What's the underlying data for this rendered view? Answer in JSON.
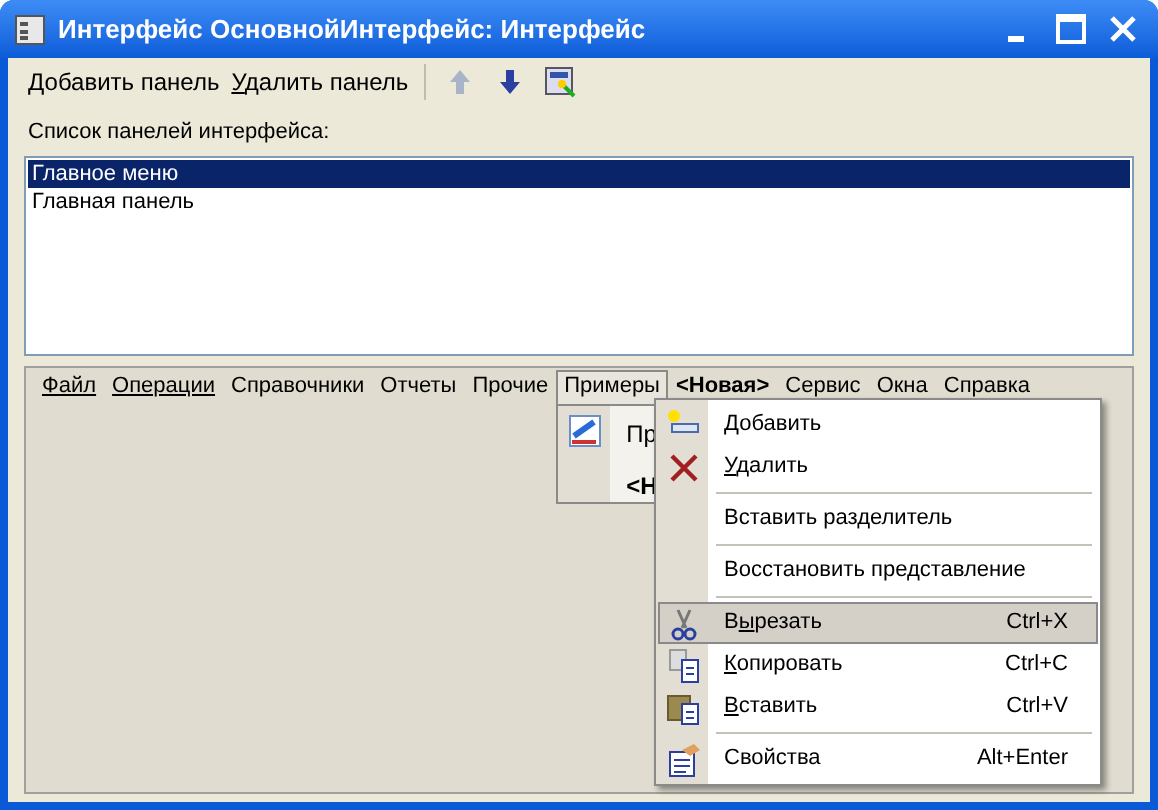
{
  "window": {
    "title": "Интерфейс ОсновнойИнтерфейс: Интерфейс"
  },
  "toolbar": [
    {
      "kind": "text",
      "key": "Д",
      "post": "обавить панель",
      "disabled": false
    },
    {
      "kind": "text",
      "key": "У",
      "post": "далить панель",
      "disabled": false
    },
    {
      "kind": "up",
      "disabled": true
    },
    {
      "kind": "down",
      "disabled": false
    },
    {
      "kind": "wizard"
    }
  ],
  "panels_label": "Список панелей интерфейса:",
  "panels": [
    {
      "label": "Главное меню",
      "selected": true
    },
    {
      "label": "Главная панель",
      "selected": false
    }
  ],
  "menu_bar": [
    {
      "label": "Файл",
      "underlined": true,
      "bold": false,
      "selected": false
    },
    {
      "label": "Операции",
      "underlined": true,
      "bold": false,
      "selected": false
    },
    {
      "label": "Справочники",
      "underlined": false,
      "bold": false,
      "selected": false
    },
    {
      "label": "Отчеты",
      "underlined": false,
      "bold": false,
      "selected": false
    },
    {
      "label": "Прочие",
      "underlined": false,
      "bold": false,
      "selected": false
    },
    {
      "label": "Примеры",
      "underlined": false,
      "bold": false,
      "selected": true
    },
    {
      "label": "<Новая>",
      "underlined": false,
      "bold": true,
      "selected": false
    },
    {
      "label": "Сервис",
      "underlined": false,
      "bold": false,
      "selected": false
    },
    {
      "label": "Окна",
      "underlined": false,
      "bold": false,
      "selected": false
    },
    {
      "label": "Справка",
      "underlined": false,
      "bold": false,
      "selected": false
    }
  ],
  "submenu": [
    {
      "label": "Пр",
      "bold": false
    },
    {
      "label": "<Н",
      "bold": true
    }
  ],
  "context_menu": [
    {
      "kind": "add",
      "key": "Д",
      "post": "обавить",
      "selected": false
    },
    {
      "kind": "delete",
      "key": "У",
      "post": "далить",
      "selected": false
    },
    {
      "kind": "separator"
    },
    {
      "kind": "plain",
      "pre": "Вставить разделитель",
      "selected": false
    },
    {
      "kind": "separator"
    },
    {
      "kind": "plain",
      "pre": "Восстановить представление",
      "selected": false
    },
    {
      "kind": "separator"
    },
    {
      "kind": "cut",
      "pre": "В",
      "key": "ы",
      "post": "резать",
      "shortcut": "Ctrl+X",
      "selected": true
    },
    {
      "kind": "copy",
      "key": "К",
      "post": "опировать",
      "shortcut": "Ctrl+C",
      "selected": false
    },
    {
      "kind": "paste",
      "key": "В",
      "post": "ставить",
      "shortcut": "Ctrl+V",
      "selected": false
    },
    {
      "kind": "separator"
    },
    {
      "kind": "properties",
      "pre": "Свойства",
      "shortcut": "Alt+Enter",
      "selected": false
    }
  ]
}
